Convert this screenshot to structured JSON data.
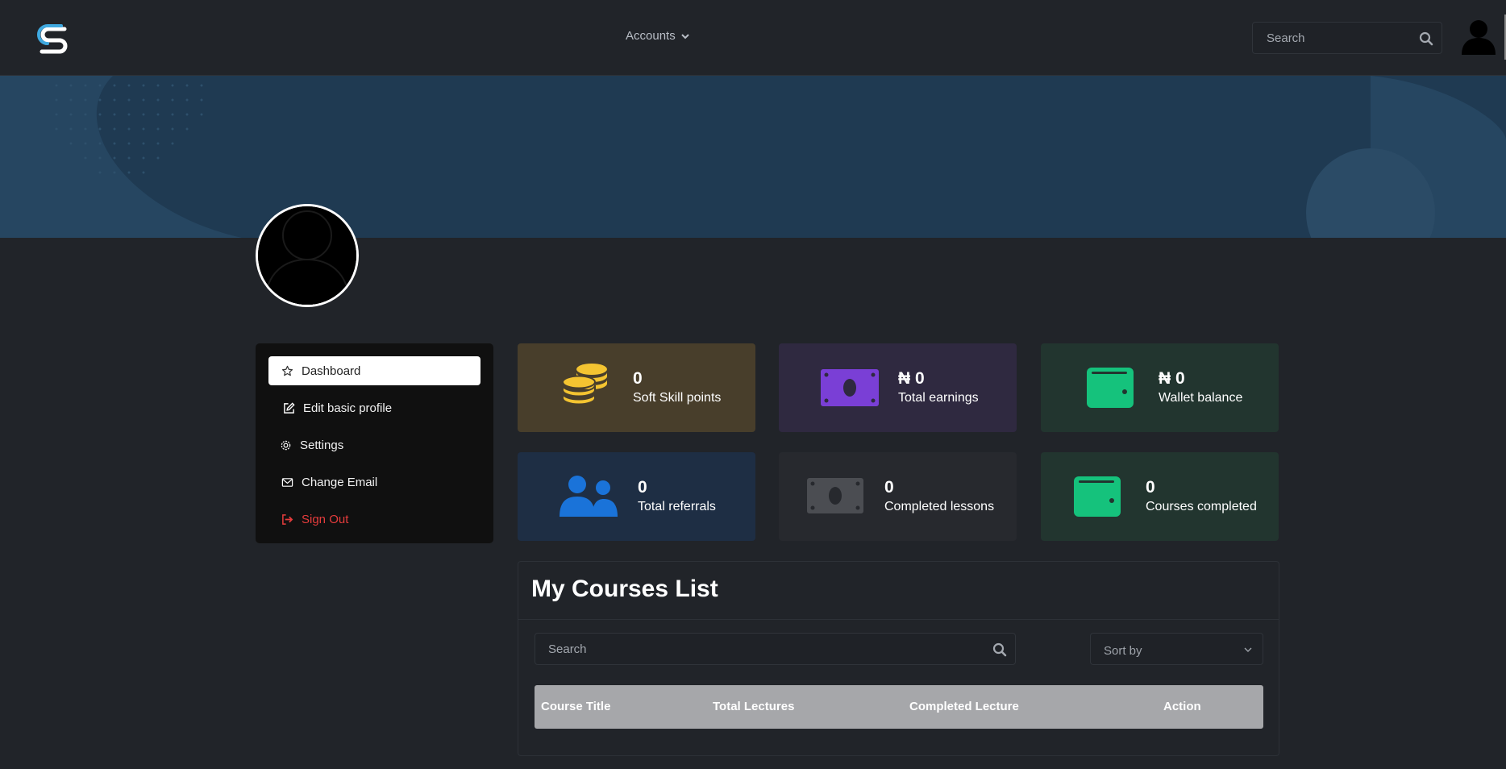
{
  "header": {
    "nav_accounts": "Accounts",
    "search_placeholder": "Search"
  },
  "sidebar": {
    "items": [
      {
        "label": "Dashboard",
        "icon": "star-icon",
        "active": true
      },
      {
        "label": "Edit basic profile",
        "icon": "edit-icon"
      },
      {
        "label": "Settings",
        "icon": "gear-icon"
      },
      {
        "label": "Change Email",
        "icon": "envelope-icon"
      },
      {
        "label": "Sign Out",
        "icon": "sign-out-icon"
      }
    ]
  },
  "stats": [
    {
      "value": "0",
      "label": "Soft Skill points",
      "icon": "coins-icon",
      "bg": "#483e2b",
      "color": "#f4c431"
    },
    {
      "value": "₦ 0",
      "label": "Total earnings",
      "icon": "money-bill-icon",
      "bg": "#2f2940",
      "color": "#7a3fd6"
    },
    {
      "value": "₦ 0",
      "label": "Wallet balance",
      "icon": "wallet-icon",
      "bg": "#22352f",
      "color": "#15c27c"
    },
    {
      "value": "0",
      "label": "Total referrals",
      "icon": "users-icon",
      "bg": "#1e2e44",
      "color": "#1a73d9"
    },
    {
      "value": "0",
      "label": "Completed lessons",
      "icon": "money-bill-icon",
      "bg": "#27292e",
      "color": "#4b4d52"
    },
    {
      "value": "0",
      "label": "Courses completed",
      "icon": "wallet-icon",
      "bg": "#22352f",
      "color": "#15c27c"
    }
  ],
  "courses": {
    "title": "My Courses List",
    "search_placeholder": "Search",
    "sort_label": "Sort by",
    "columns": [
      "Course Title",
      "Total Lectures",
      "Completed Lecture",
      "Action"
    ],
    "rows": []
  },
  "colors": {
    "page_bg": "#212429",
    "banner": "#1f3a52",
    "sign_out": "#e53c3c",
    "logo_accent": "#3fa9e0"
  }
}
